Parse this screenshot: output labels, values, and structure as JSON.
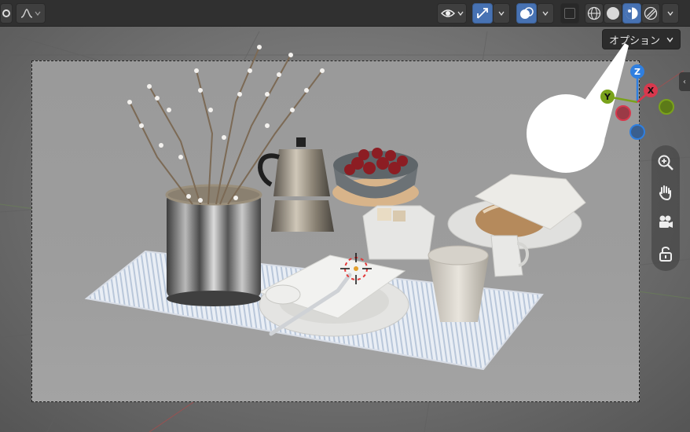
{
  "toolbar": {
    "options_label": "オプション",
    "icons": [
      "object-mode-icon",
      "curve-icon",
      "visibility-icon",
      "gizmo-icon",
      "overlay-icon",
      "xray-icon",
      "wireframe-shading-icon",
      "solid-shading-icon",
      "material-preview-shading-icon",
      "rendered-shading-icon"
    ]
  },
  "gizmo": {
    "z_label": "Z",
    "y_label": "Y",
    "x_label": "X",
    "colors": {
      "z": "#2f7fe0",
      "y": "#7aa21b",
      "x": "#d8384d"
    }
  },
  "navigation": {
    "tools": [
      "zoom-icon",
      "pan-hand-icon",
      "camera-view-icon",
      "lock-icon"
    ]
  },
  "colors": {
    "accent": "#4772b3",
    "background": "#303030"
  }
}
